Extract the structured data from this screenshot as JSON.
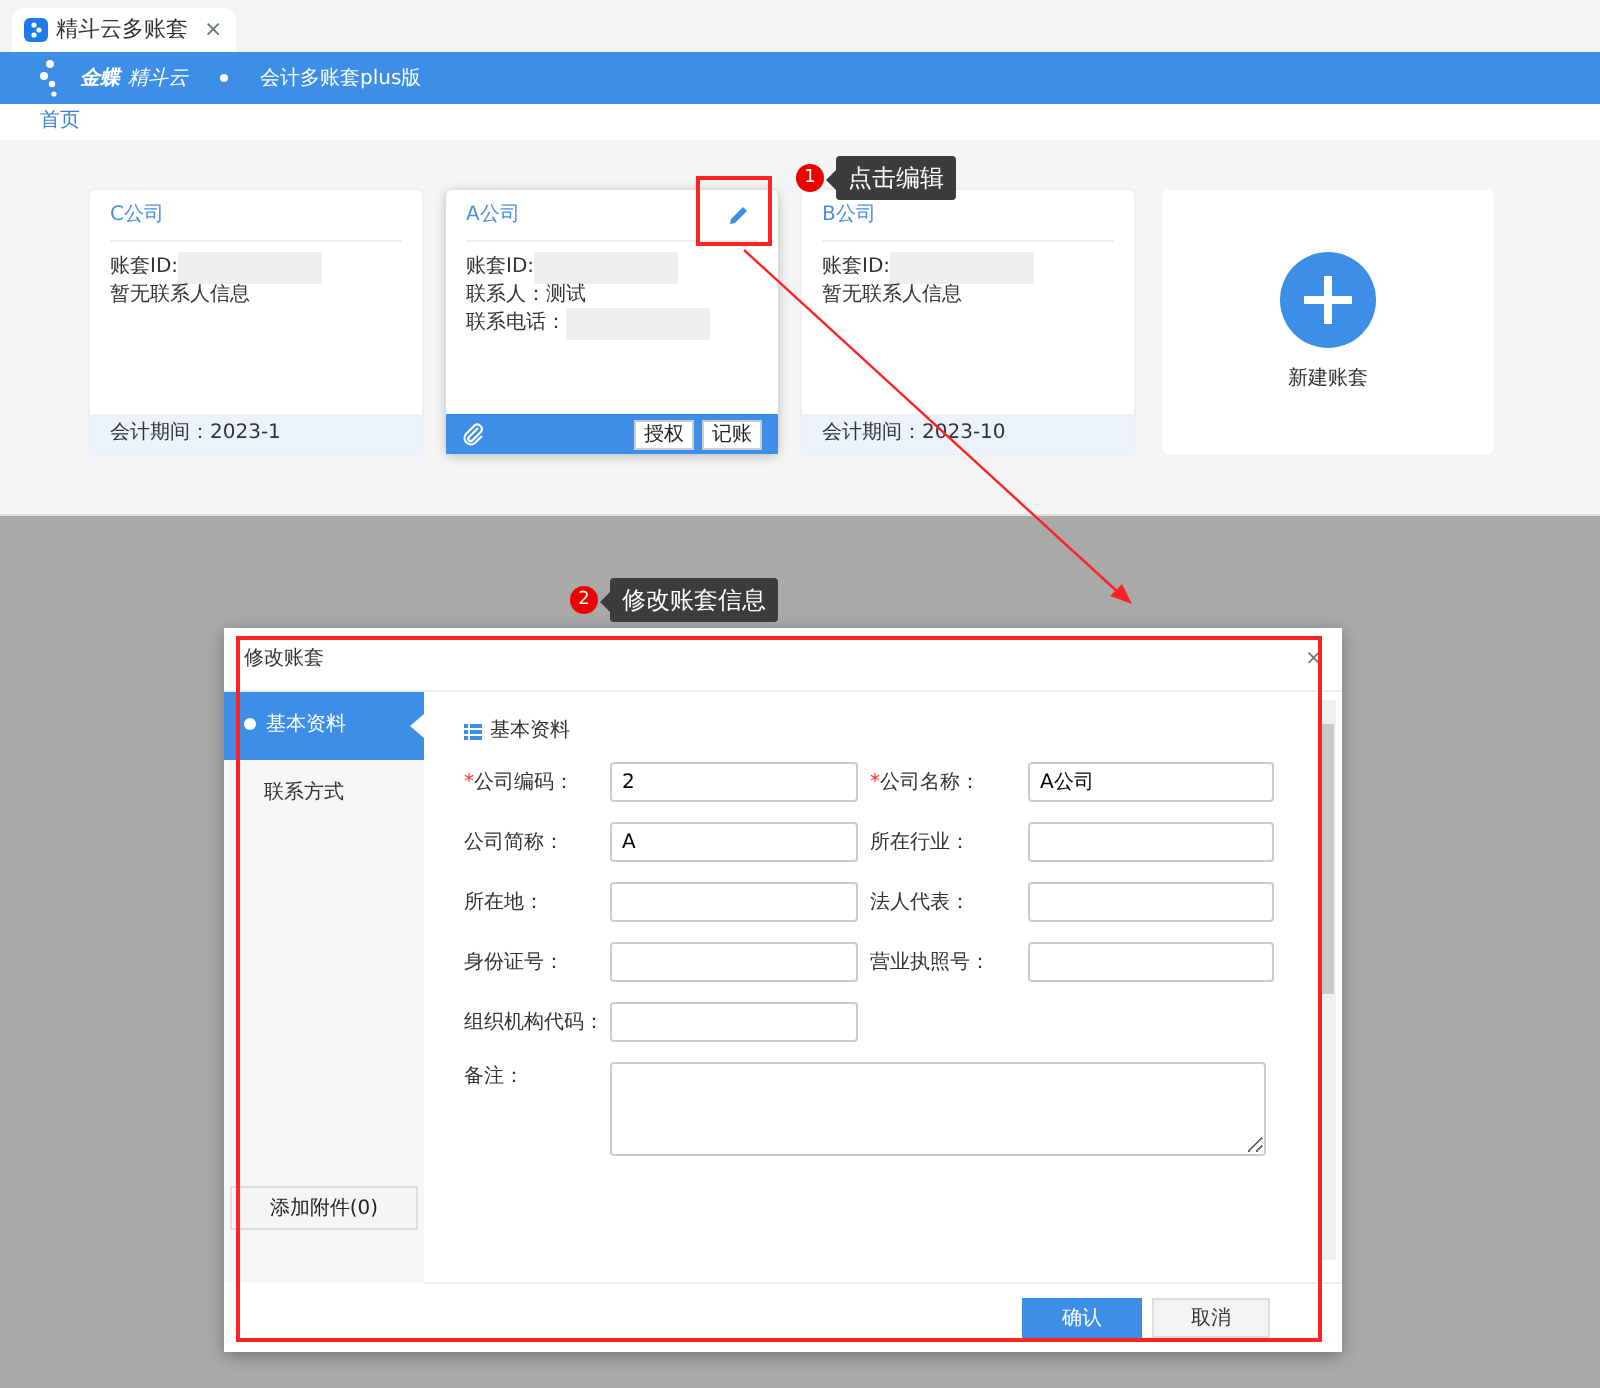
{
  "tab": {
    "title": "精斗云多账套",
    "close": "×"
  },
  "header": {
    "brand": "金蝶",
    "brand_sub": "精斗云",
    "product": "会计多账套plus版"
  },
  "breadcrumb": "首页",
  "accounts": [
    {
      "name": "C公司",
      "hovered": false,
      "lines": [
        {
          "label": "账套ID:",
          "redacted": true
        },
        {
          "label": "暂无联系人信息",
          "redacted": false
        }
      ],
      "period": "会计期间：2023-1"
    },
    {
      "name": "A公司",
      "hovered": true,
      "lines": [
        {
          "label": "账套ID:",
          "redacted": true
        },
        {
          "label": "联系人：",
          "value": "测试",
          "redacted": false
        },
        {
          "label": "联系电话：",
          "redacted": true
        }
      ],
      "actions": [
        "授权",
        "记账"
      ]
    },
    {
      "name": "B公司",
      "hovered": false,
      "lines": [
        {
          "label": "账套ID:",
          "redacted": true
        },
        {
          "label": "暂无联系人信息",
          "redacted": false
        }
      ],
      "period": "会计期间：2023-10"
    }
  ],
  "new_account": {
    "label": "新建账套"
  },
  "modal": {
    "title": "修改账套",
    "close": "×",
    "nav": [
      {
        "label": "基本资料",
        "selected": true
      },
      {
        "label": "联系方式",
        "selected": false
      }
    ],
    "attachment_button": "添加附件(0)",
    "section_title": "基本资料",
    "fields": [
      {
        "mark": "*",
        "label": "公司编码：",
        "value": "2",
        "kind": "input"
      },
      {
        "mark": "*",
        "label": "公司名称：",
        "value": "A公司",
        "kind": "input"
      },
      {
        "label": "公司简称：",
        "value": "A",
        "kind": "input"
      },
      {
        "label": "所在行业：",
        "kind": "input"
      },
      {
        "label": "所在地：",
        "kind": "input"
      },
      {
        "label": "法人代表：",
        "kind": "input"
      },
      {
        "label": "身份证号：",
        "kind": "input"
      },
      {
        "label": "营业执照号：",
        "kind": "input"
      },
      {
        "label": "组织机构代码：",
        "kind": "input"
      },
      {
        "label": "备注：",
        "kind": "textarea"
      }
    ],
    "buttons": [
      {
        "label": "确认",
        "kind": "primary"
      },
      {
        "label": "取消",
        "kind": "secondary"
      }
    ]
  },
  "annotations": [
    {
      "number": "1",
      "text": "点击编辑"
    },
    {
      "number": "2",
      "text": "修改账套信息"
    }
  ]
}
